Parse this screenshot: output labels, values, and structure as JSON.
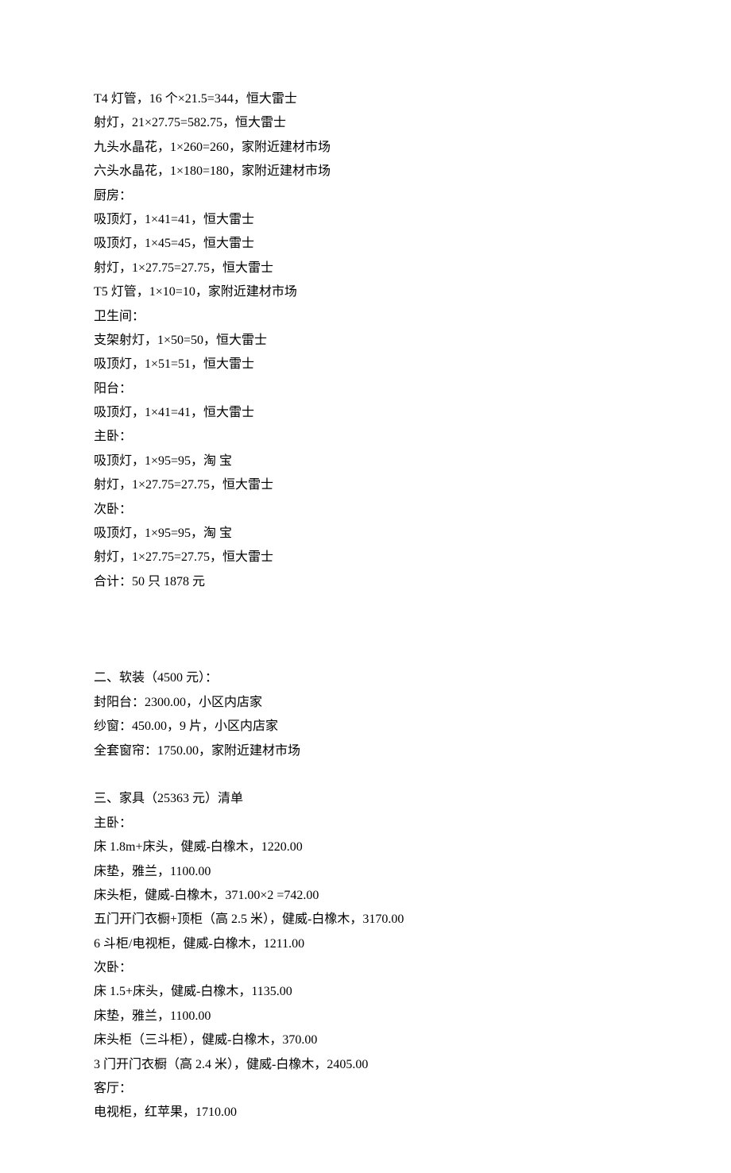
{
  "lines": [
    "T4 灯管，16 个×21.5=344，恒大雷士",
    "射灯，21×27.75=582.75，恒大雷士",
    "九头水晶花，1×260=260，家附近建材市场",
    "六头水晶花，1×180=180，家附近建材市场",
    "厨房：",
    "吸顶灯，1×41=41，恒大雷士",
    "吸顶灯，1×45=45，恒大雷士",
    "射灯，1×27.75=27.75，恒大雷士",
    "T5 灯管，1×10=10，家附近建材市场",
    "卫生间：",
    "支架射灯，1×50=50，恒大雷士",
    "吸顶灯，1×51=51，恒大雷士",
    "阳台：",
    "吸顶灯，1×41=41，恒大雷士",
    "主卧：",
    "吸顶灯，1×95=95，淘 宝",
    "射灯，1×27.75=27.75，恒大雷士",
    "次卧：",
    "吸顶灯，1×95=95，淘 宝",
    "射灯，1×27.75=27.75，恒大雷士",
    "合计：50 只 1878 元"
  ],
  "section2": [
    "二、软装（4500 元）：",
    "封阳台：2300.00，小区内店家",
    "纱窗：450.00，9 片，小区内店家",
    "全套窗帘：1750.00，家附近建材市场"
  ],
  "section3": [
    "三、家具（25363 元）清单",
    "主卧：",
    "床 1.8m+床头，健威-白橡木，1220.00",
    "床垫，雅兰，1100.00",
    "床头柜，健威-白橡木，371.00×2 =742.00",
    "五门开门衣橱+顶柜（高 2.5 米），健威-白橡木，3170.00",
    "6 斗柜/电视柜，健威-白橡木，1211.00",
    "次卧：",
    "床 1.5+床头，健威-白橡木，1135.00",
    "床垫，雅兰，1100.00",
    "床头柜（三斗柜），健威-白橡木，370.00",
    "3 门开门衣橱（高 2.4 米），健威-白橡木，2405.00",
    "客厅：",
    "电视柜，红苹果，1710.00"
  ]
}
